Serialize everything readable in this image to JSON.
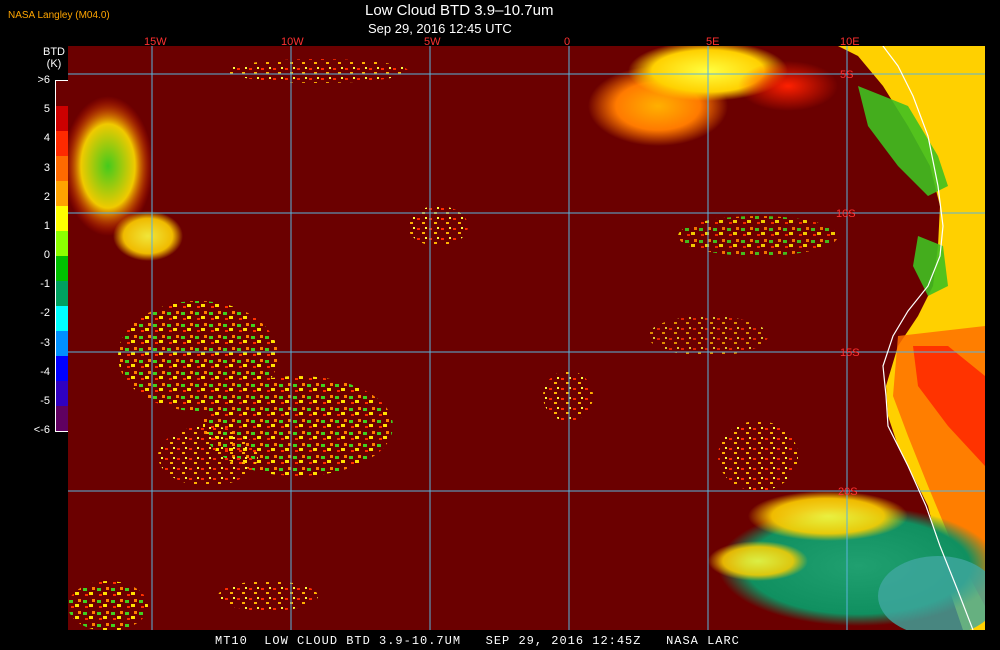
{
  "header": {
    "title": "Low Cloud BTD 3.9–10.7um",
    "subtitle": "Sep 29, 2016 12:45 UTC",
    "credit": "NASA Langley (M04.0)"
  },
  "colorbar": {
    "unit_line1": "BTD",
    "unit_line2": "(K)",
    "labels": [
      ">6",
      "5",
      "4",
      "3",
      "2",
      "1",
      "0",
      "-1",
      "-2",
      "-3",
      "-4",
      "-5",
      "<-6"
    ],
    "colors": [
      "#6b0000",
      "#cc0000",
      "#ff2a00",
      "#ff6a00",
      "#ffa200",
      "#ffff00",
      "#8cff00",
      "#00c000",
      "#00a060",
      "#00ffff",
      "#0090ff",
      "#0000ff",
      "#3000c0",
      "#600060"
    ]
  },
  "grid": {
    "lon_labels": [
      "15W",
      "10W",
      "5W",
      "0",
      "5E",
      "10E"
    ],
    "lat_labels": [
      "5S",
      "10S",
      "15S",
      "20S"
    ]
  },
  "footer": {
    "text": "MT10  LOW CLOUD BTD 3.9-10.7UM   SEP 29, 2016 12:45Z   NASA LARC"
  },
  "colors": {
    "background": "#6b0000",
    "grid": "#5ab4dc",
    "grid_label": "#ff3030",
    "coast": "#ffffff"
  }
}
